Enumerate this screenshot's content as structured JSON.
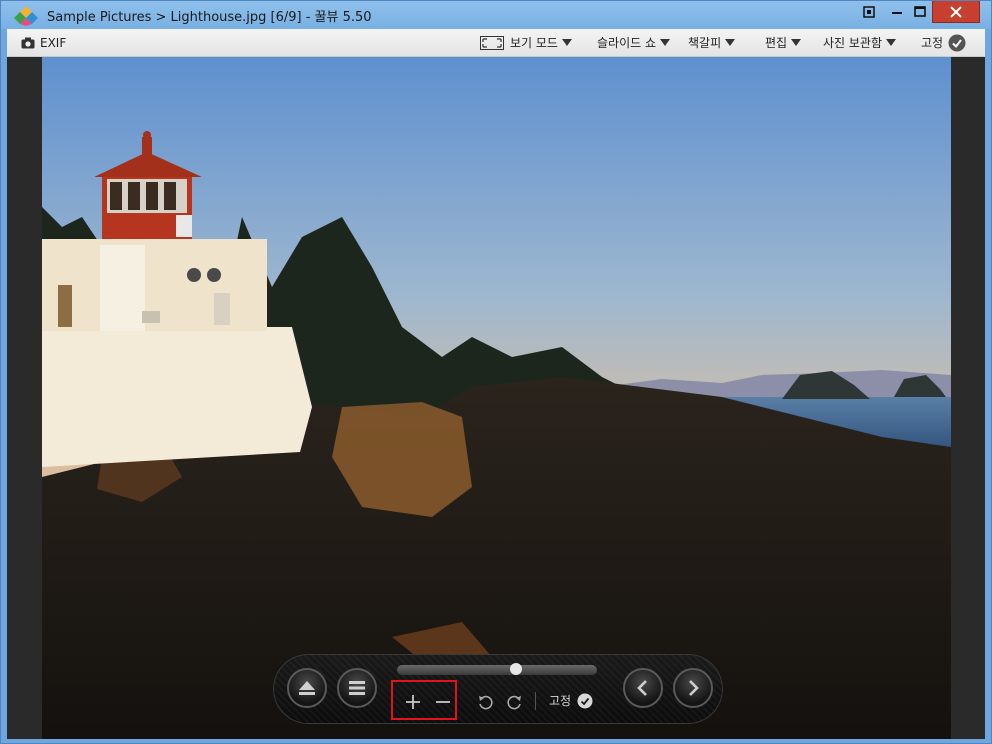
{
  "window": {
    "title": "Sample Pictures > Lighthouse.jpg [6/9] - 꿀뷰 5.50"
  },
  "toolbar": {
    "exif_label": "EXIF",
    "view_mode_label": "보기 모드",
    "slideshow_label": "슬라이드 쇼",
    "bookmark_label": "책갈피",
    "edit_label": "편집",
    "photo_storage_label": "사진 보관함",
    "pin_label": "고정"
  },
  "controls": {
    "fixed_label": "고정",
    "slider_position": 0.6
  },
  "colors": {
    "titlebar": "#8fc0ec",
    "close_button": "#c7402f",
    "highlight_box": "#e0141c"
  },
  "icons": {
    "app": "app-logo-icon",
    "camera": "camera-icon",
    "fit": "fit-screen-icon",
    "eject": "eject-icon",
    "menu": "menu-icon",
    "zoom_in": "plus-icon",
    "zoom_out": "minus-icon",
    "rotate_left": "rotate-left-icon",
    "rotate_right": "rotate-right-icon",
    "prev": "chevron-left-icon",
    "next": "chevron-right-icon",
    "check": "check-circle-icon"
  }
}
